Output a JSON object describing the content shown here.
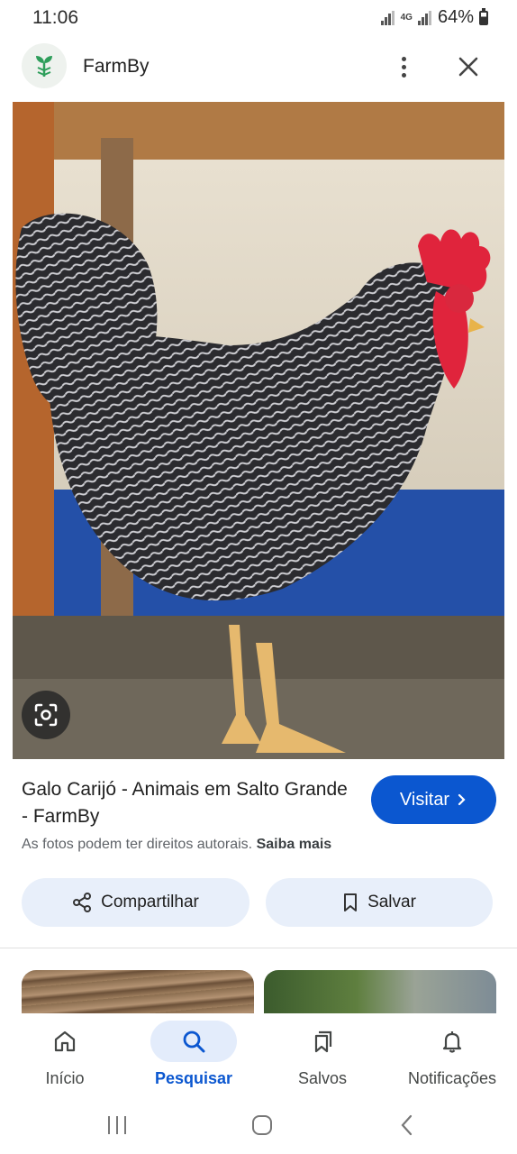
{
  "status_bar": {
    "time": "11:06",
    "network": "4G",
    "battery": "64%"
  },
  "header": {
    "title": "FarmBy",
    "logo_icon": "farm-plant-icon"
  },
  "result": {
    "title": "Galo Carijó - Animais em Salto Grande - FarmBy",
    "visit_label": "Visitar",
    "copyright_text": "As fotos podem ter direitos autorais.",
    "learn_more": "Saiba mais"
  },
  "actions": {
    "share_label": "Compartilhar",
    "save_label": "Salvar"
  },
  "bottom_nav": {
    "items": [
      {
        "label": "Início",
        "icon": "home-icon"
      },
      {
        "label": "Pesquisar",
        "icon": "search-icon"
      },
      {
        "label": "Salvos",
        "icon": "bookmarks-icon"
      },
      {
        "label": "Notificações",
        "icon": "bell-icon"
      }
    ],
    "active": "Pesquisar"
  },
  "colors": {
    "accent": "#0b57d0",
    "action_bg": "#e8effa",
    "active_pill": "#e3ecfb"
  }
}
